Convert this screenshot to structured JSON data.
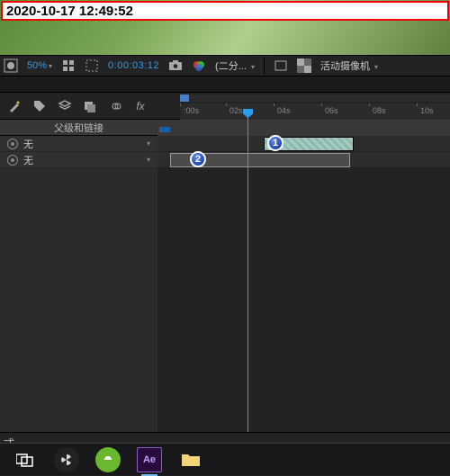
{
  "overlay": {
    "timestamp": "2020-10-17 12:49:52"
  },
  "toolbar": {
    "zoom": "50%",
    "timecode": "0:00:03:12",
    "resolution_label": "(二分...",
    "camera_label": "活动摄像机"
  },
  "ruler": {
    "ticks": [
      ":00s",
      "02s",
      "04s",
      "06s",
      "08s",
      "10s"
    ]
  },
  "left_panel": {
    "header": "父级和链接",
    "rows": [
      {
        "label": "无"
      },
      {
        "label": "无"
      }
    ]
  },
  "callouts": {
    "a": "1",
    "b": "2"
  },
  "style_label": "式",
  "taskbar": {
    "ae": "Ae"
  },
  "icons": {
    "mask": "mask-icon",
    "grid": "grid-icon",
    "bounds": "bounds-icon",
    "camera": "camera-icon",
    "clock": "clock-icon",
    "color": "color-wheel-icon",
    "window": "window-icon",
    "transparency": "transparency-grid-icon",
    "wand": "wand-icon",
    "tag": "tag-icon",
    "layers1": "layers-icon",
    "layers2": "layers2-icon",
    "link": "link-icon",
    "fx": "fx-icon"
  }
}
